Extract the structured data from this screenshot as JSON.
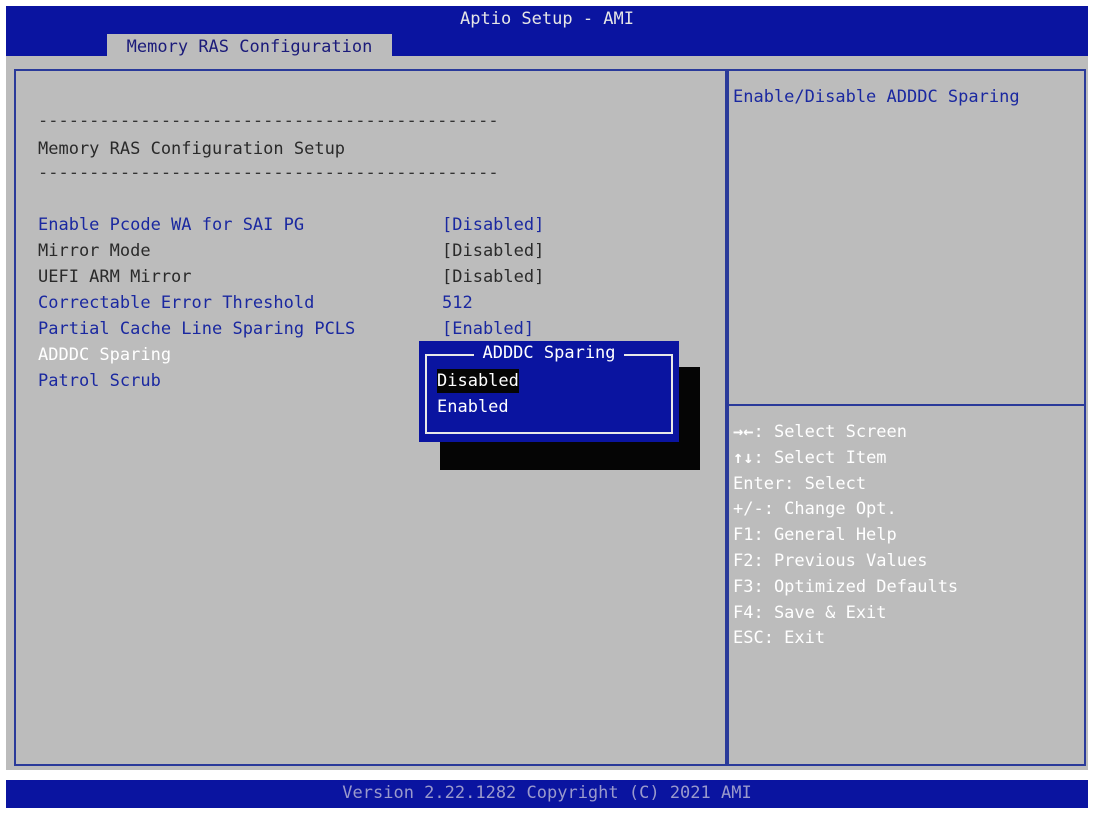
{
  "app": {
    "title": "Aptio Setup - AMI",
    "tab": "Memory RAS Configuration",
    "version": "Version 2.22.1282 Copyright (C) 2021 AMI"
  },
  "main": {
    "separator": "---------------------------------------------",
    "heading": "Memory RAS Configuration Setup",
    "items": [
      {
        "label": "Enable Pcode WA for SAI PG",
        "value": "[Disabled]"
      },
      {
        "label": "Mirror Mode",
        "value": "[Disabled]"
      },
      {
        "label": "UEFI ARM Mirror",
        "value": "[Disabled]"
      },
      {
        "label": "Correctable Error Threshold",
        "value": "512"
      },
      {
        "label": "Partial Cache Line Sparing PCLS",
        "value": "[Enabled]"
      },
      {
        "label": "ADDDC Sparing",
        "value": ""
      },
      {
        "label": "Patrol Scrub",
        "value": ""
      }
    ]
  },
  "popup": {
    "title": "ADDDC Sparing",
    "options": [
      "Disabled",
      "Enabled"
    ],
    "selected": "Disabled"
  },
  "help": {
    "description": "Enable/Disable ADDDC Sparing",
    "keys": [
      {
        "key": "→←",
        "action": ": Select Screen"
      },
      {
        "key": "↑↓",
        "action": ": Select Item"
      },
      {
        "key": "",
        "action": "Enter: Select"
      },
      {
        "key": "",
        "action": "+/-: Change Opt."
      },
      {
        "key": "",
        "action": "F1: General Help"
      },
      {
        "key": "",
        "action": "F2: Previous Values"
      },
      {
        "key": "",
        "action": "F3: Optimized Defaults"
      },
      {
        "key": "",
        "action": "F4: Save & Exit"
      },
      {
        "key": "",
        "action": "ESC: Exit"
      }
    ]
  },
  "colors": {
    "bios_blue": "#0a14a0",
    "panel_gray": "#bcbcbc",
    "item_blue": "#1a28a0"
  }
}
